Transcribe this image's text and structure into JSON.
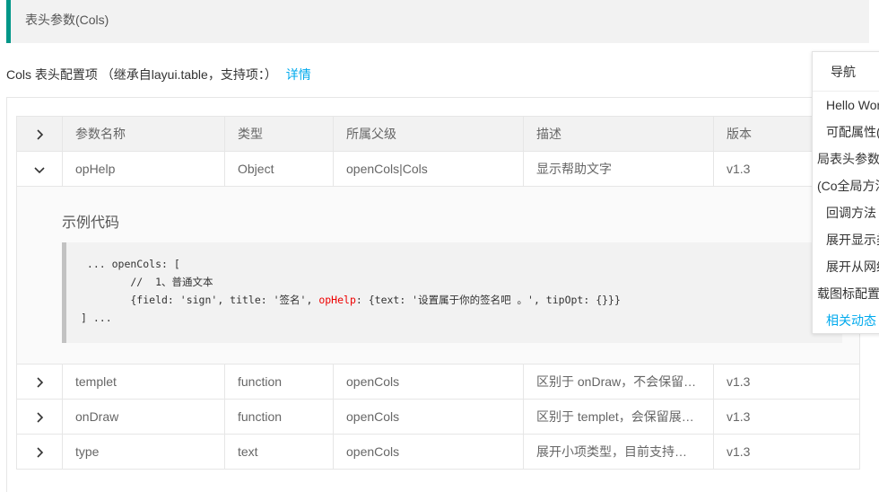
{
  "header": {
    "title": "表头参数(Cols)"
  },
  "subtitle": {
    "text": "Cols 表头配置项 （继承自layui.table，支持项：）",
    "link": "详情"
  },
  "table": {
    "columns": [
      "参数名称",
      "类型",
      "所属父级",
      "描述",
      "版本"
    ],
    "rows": [
      {
        "name": "opHelp",
        "type": "Object",
        "parent": "openCols|Cols",
        "desc": "显示帮助文字",
        "version": "v1.3",
        "expanded": true
      },
      {
        "name": "templet",
        "type": "function",
        "parent": "openCols",
        "desc": "区别于 onDraw，不会保留…",
        "version": "v1.3"
      },
      {
        "name": "onDraw",
        "type": "function",
        "parent": "openCols",
        "desc": "区别于 templet，会保留展…",
        "version": "v1.3"
      },
      {
        "name": "type",
        "type": "text",
        "parent": "openCols",
        "desc": "展开小项类型，目前支持…",
        "version": "v1.3"
      }
    ]
  },
  "example": {
    "title": "示例代码",
    "line1": " ... openCols: [",
    "line2": "        //  1、普通文本",
    "line3a": "        {field: 'sign', title: '签名', ",
    "line3b": "opHelp",
    "line3c": ": {text: '设置属于你的签名吧 。', tipOpt: {}}}",
    "line4": "] ..."
  },
  "nav": {
    "title": "导航",
    "items": [
      {
        "label": "Hello World"
      },
      {
        "label": "可配属性("
      },
      {
        "label": "局表头参数"
      },
      {
        "label": "(Co全局方法"
      },
      {
        "label": "回调方法"
      },
      {
        "label": "展开显示类"
      },
      {
        "label": "展开从网络"
      },
      {
        "label": "载图标配置"
      },
      {
        "label": "相关动态"
      }
    ]
  },
  "colors": {
    "accent": "#009688",
    "link": "#01AAED",
    "highlight": "#ee0000"
  }
}
